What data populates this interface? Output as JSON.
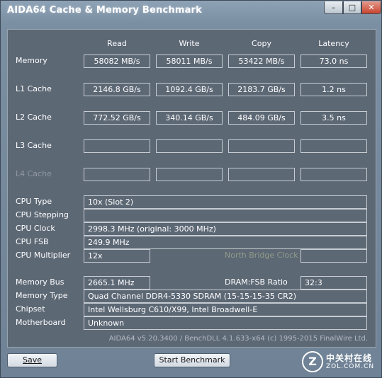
{
  "window": {
    "title": "AIDA64 Cache & Memory Benchmark",
    "minimize": "–",
    "maximize": "□",
    "close": "✕"
  },
  "columns": [
    "Read",
    "Write",
    "Copy",
    "Latency"
  ],
  "rows": [
    {
      "label": "Memory",
      "values": [
        "58082 MB/s",
        "58011 MB/s",
        "53422 MB/s",
        "73.0 ns"
      ]
    },
    {
      "label": "L1 Cache",
      "values": [
        "2146.8 GB/s",
        "1092.4 GB/s",
        "2183.7 GB/s",
        "1.2 ns"
      ]
    },
    {
      "label": "L2 Cache",
      "values": [
        "772.52 GB/s",
        "340.14 GB/s",
        "484.09 GB/s",
        "3.5 ns"
      ]
    },
    {
      "label": "L3 Cache",
      "values": [
        "",
        "",
        "",
        ""
      ]
    },
    {
      "label": "L4 Cache",
      "values": [
        "",
        "",
        "",
        ""
      ]
    }
  ],
  "cpu": {
    "type_label": "CPU Type",
    "type_value": "10x   (Slot 2)",
    "stepping_label": "CPU Stepping",
    "stepping_value": "",
    "clock_label": "CPU Clock",
    "clock_value": "2998.3 MHz  (original: 3000 MHz)",
    "fsb_label": "CPU FSB",
    "fsb_value": "249.9 MHz",
    "multiplier_label": "CPU Multiplier",
    "multiplier_value": "12x",
    "north_bridge_label": "North Bridge Clock",
    "north_bridge_value": ""
  },
  "memory": {
    "bus_label": "Memory Bus",
    "bus_value": "2665.1 MHz",
    "ratio_label": "DRAM:FSB Ratio",
    "ratio_value": "32:3",
    "type_label": "Memory Type",
    "type_value": "Quad Channel DDR4-5330 SDRAM  (15-15-15-35 CR2)",
    "chipset_label": "Chipset",
    "chipset_value": "Intel Wellsburg C610/X99, Intel Broadwell-E",
    "motherboard_label": "Motherboard",
    "motherboard_value": "Unknown"
  },
  "footer": "AIDA64 v5.20.3400 / BenchDLL 4.1.633-x64  (c) 1995-2015 FinalWire Ltd.",
  "buttons": {
    "save": "Save",
    "start": "Start Benchmark"
  },
  "watermark": {
    "logo": "Z",
    "cn": "中关村在线",
    "en": "ZOL.COM.CN"
  }
}
